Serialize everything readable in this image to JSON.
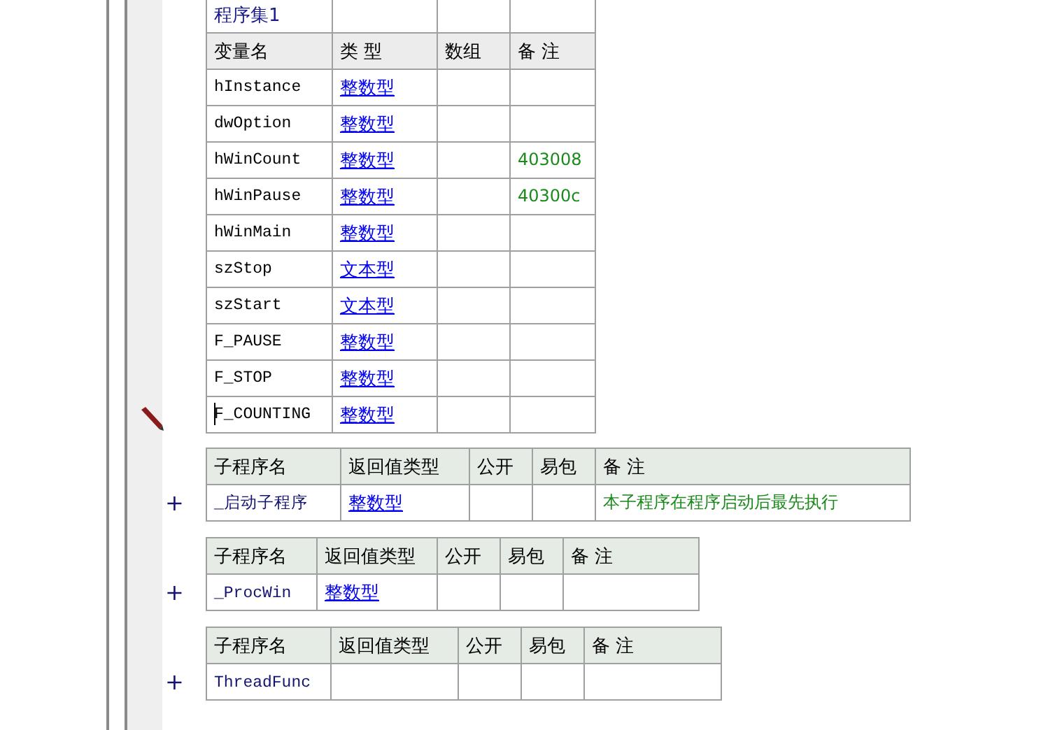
{
  "program_set": {
    "name": "程序集1"
  },
  "variables": {
    "columns": [
      "变量名",
      "类 型",
      "数组",
      "备 注"
    ],
    "rows": [
      {
        "name": "hInstance",
        "type": "整数型"
      },
      {
        "name": "dwOption",
        "type": "整数型"
      },
      {
        "name": "hWinCount",
        "type": "整数型",
        "remark": "403008"
      },
      {
        "name": "hWinPause",
        "type": "整数型",
        "remark": "40300c"
      },
      {
        "name": "hWinMain",
        "type": "整数型"
      },
      {
        "name": "szStop",
        "type": "文本型"
      },
      {
        "name": "szStart",
        "type": "文本型"
      },
      {
        "name": "F_PAUSE",
        "type": "整数型"
      },
      {
        "name": "F_STOP",
        "type": "整数型"
      },
      {
        "name": "F_COUNTING",
        "type": "整数型",
        "cursor": true
      }
    ]
  },
  "subroutines": [
    {
      "columns": [
        "子程序名",
        "返回值类型",
        "公开",
        "易包",
        "备 注"
      ],
      "expanded": false,
      "toggle": "+",
      "name": "_启动子程序",
      "return_type": "整数型",
      "remark": "本子程序在程序启动后最先执行"
    },
    {
      "columns": [
        "子程序名",
        "返回值类型",
        "公开",
        "易包",
        "备 注"
      ],
      "expanded": false,
      "toggle": "+",
      "name": "_ProcWin",
      "return_type": "整数型"
    },
    {
      "columns": [
        "子程序名",
        "返回值类型",
        "公开",
        "易包",
        "备 注"
      ],
      "expanded": false,
      "toggle": "+",
      "name": "ThreadFunc"
    }
  ]
}
